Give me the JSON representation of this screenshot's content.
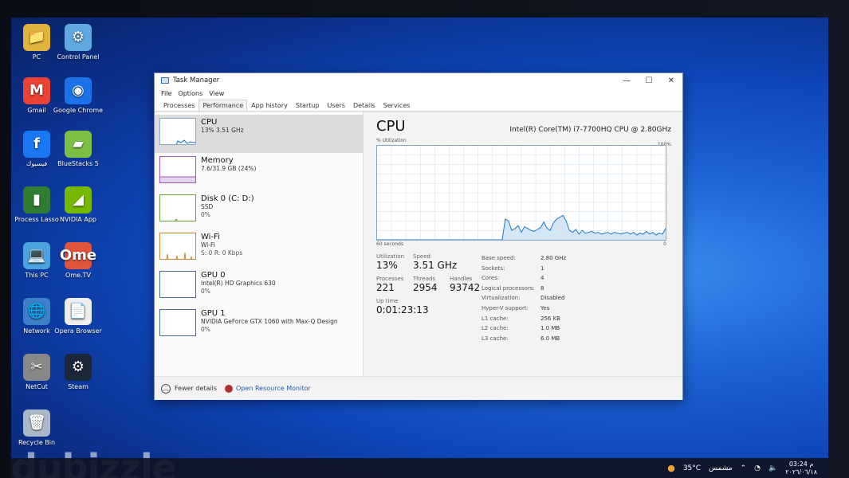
{
  "desktop": {
    "icons": [
      {
        "label": "PC",
        "glyph": "📁"
      },
      {
        "label": "Control Panel",
        "glyph": "⚙"
      },
      {
        "label": "Gmail",
        "glyph": "M"
      },
      {
        "label": "Google Chrome",
        "glyph": "◉"
      },
      {
        "label": "فيسبوك",
        "glyph": "f"
      },
      {
        "label": "BlueStacks 5",
        "glyph": "▰"
      },
      {
        "label": "Process Lasso",
        "glyph": "▮"
      },
      {
        "label": "NVIDIA App",
        "glyph": "◢"
      },
      {
        "label": "This PC",
        "glyph": "💻"
      },
      {
        "label": "Ome.TV",
        "glyph": "Ome"
      },
      {
        "label": "Network",
        "glyph": "🌐"
      },
      {
        "label": "Opera Browser",
        "glyph": "📄"
      },
      {
        "label": "NetCut",
        "glyph": "✂"
      },
      {
        "label": "Steam",
        "glyph": "⚙"
      },
      {
        "label": "Recycle Bin",
        "glyph": "🗑"
      }
    ],
    "watermark": "dubizzle"
  },
  "taskbar": {
    "weather": "35°C",
    "weather_label": "مشمس",
    "time": "03:24 م",
    "date": "٢٠٢٦/٠٦/١٨"
  },
  "taskmanager": {
    "title": "Task Manager",
    "menu": [
      "File",
      "Options",
      "View"
    ],
    "tabs": [
      "Processes",
      "Performance",
      "App history",
      "Startup",
      "Users",
      "Details",
      "Services"
    ],
    "active_tab": "Performance",
    "sidebar": [
      {
        "name": "CPU",
        "sub": "13% 3.51 GHz",
        "sub2": ""
      },
      {
        "name": "Memory",
        "sub": "7.6/31.9 GB (24%)",
        "sub2": ""
      },
      {
        "name": "Disk 0 (C: D:)",
        "sub": "SSD",
        "sub2": "0%"
      },
      {
        "name": "Wi-Fi",
        "sub": "Wi-Fi",
        "sub2": "S: 0 R: 0 Kbps"
      },
      {
        "name": "GPU 0",
        "sub": "Intel(R) HD Graphics 630",
        "sub2": "0%"
      },
      {
        "name": "GPU 1",
        "sub": "NVIDIA GeForce GTX 1060 with Max-Q Design",
        "sub2": "0%"
      }
    ],
    "cpu": {
      "title": "CPU",
      "model": "Intel(R) Core(TM) i7-7700HQ CPU @ 2.80GHz",
      "util_label": "% Utilization",
      "max_label": "100%",
      "axis_left": "60 seconds",
      "axis_right": "0",
      "utilization_label": "Utilization",
      "utilization": "13%",
      "speed_label": "Speed",
      "speed": "3.51 GHz",
      "processes_label": "Processes",
      "processes": "221",
      "threads_label": "Threads",
      "threads": "2954",
      "handles_label": "Handles",
      "handles": "93742",
      "uptime_label": "Up time",
      "uptime": "0:01:23:13",
      "specs": [
        {
          "k": "Base speed:",
          "v": "2.80 GHz"
        },
        {
          "k": "Sockets:",
          "v": "1"
        },
        {
          "k": "Cores:",
          "v": "4"
        },
        {
          "k": "Logical processors:",
          "v": "8"
        },
        {
          "k": "Virtualization:",
          "v": "Disabled"
        },
        {
          "k": "Hyper-V support:",
          "v": "Yes"
        },
        {
          "k": "L1 cache:",
          "v": "256 KB"
        },
        {
          "k": "L2 cache:",
          "v": "1.0 MB"
        },
        {
          "k": "L3 cache:",
          "v": "6.0 MB"
        }
      ],
      "history": [
        0,
        0,
        0,
        0,
        0,
        0,
        0,
        0,
        0,
        0,
        0,
        0,
        0,
        0,
        0,
        0,
        0,
        0,
        0,
        0,
        0,
        0,
        0,
        0,
        0,
        0,
        0,
        0,
        0,
        0,
        0,
        0,
        0,
        0,
        0,
        0,
        0,
        0,
        0,
        0,
        22,
        20,
        10,
        12,
        15,
        8,
        14,
        12,
        10,
        9,
        11,
        13,
        19,
        12,
        10,
        18,
        22,
        24,
        26,
        20,
        10,
        8,
        11,
        6,
        10,
        7,
        8,
        9,
        7,
        8,
        6,
        7,
        8,
        6,
        8,
        7,
        6,
        7,
        8,
        6,
        8,
        5,
        7,
        6,
        9,
        6,
        8,
        5,
        7,
        6,
        12
      ]
    },
    "footer": {
      "fewer_details": "Fewer details",
      "open_resource_monitor": "Open Resource Monitor"
    },
    "accent_cpu": "#1b77c9"
  }
}
